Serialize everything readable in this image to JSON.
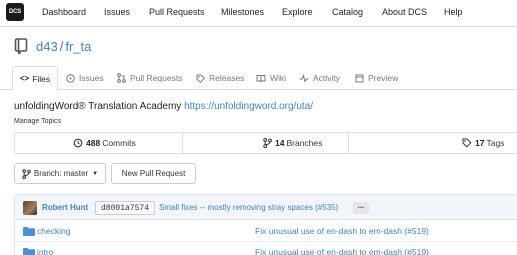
{
  "nav": {
    "logo": "DCS",
    "items": [
      "Dashboard",
      "Issues",
      "Pull Requests",
      "Milestones",
      "Explore",
      "Catalog",
      "About DCS",
      "Help"
    ]
  },
  "repo": {
    "owner": "d43",
    "separator": "/",
    "name": "fr_ta"
  },
  "tabs": [
    "Files",
    "Issues",
    "Pull Requests",
    "Releases",
    "Wiki",
    "Activity",
    "Preview"
  ],
  "description": {
    "text": "unfoldingWord® Translation Academy",
    "link": "https://unfoldingword.org/uta/"
  },
  "manage_topics": "Manage Topics",
  "stats": {
    "commits_count": "488",
    "commits_label": "Commits",
    "branches_count": "14",
    "branches_label": "Branches",
    "tags_count": "17",
    "tags_label": "Tags"
  },
  "branch_button": "Branch: master",
  "new_pr_button": "New Pull Request",
  "commit": {
    "author": "Robert Hunt",
    "sha": "d8001a7574",
    "message": "Small fixes -- mostly removing stray spaces (#535)",
    "more": "..."
  },
  "files": [
    {
      "name": "checking",
      "message": "Fix unusual use of en-dash to em-dash (#519)"
    },
    {
      "name": "intro",
      "message": "Fix unusual use of en-dash to em-dash (#519)"
    }
  ]
}
